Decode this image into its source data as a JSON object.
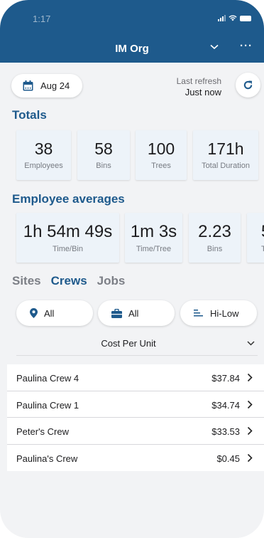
{
  "status": {
    "time": "1:17"
  },
  "header": {
    "title": "IM Org"
  },
  "date": {
    "label": "Aug 24"
  },
  "refresh": {
    "label": "Last refresh",
    "value": "Just now"
  },
  "totals": {
    "title": "Totals",
    "cards": [
      {
        "value": "38",
        "label": "Employees"
      },
      {
        "value": "58",
        "label": "Bins"
      },
      {
        "value": "100",
        "label": "Trees"
      },
      {
        "value": "171h",
        "label": "Total Duration"
      }
    ]
  },
  "averages": {
    "title": "Employee averages",
    "cards": [
      {
        "value": "1h 54m 49s",
        "label": "Time/Bin"
      },
      {
        "value": "1m 3s",
        "label": "Time/Tree"
      },
      {
        "value": "2.23",
        "label": "Bins"
      },
      {
        "value": "5",
        "label": "T"
      }
    ]
  },
  "tabs": [
    "Sites",
    "Crews",
    "Jobs"
  ],
  "active_tab": "Crews",
  "filters": {
    "site": "All",
    "job": "All",
    "order": "Hi-Low"
  },
  "sort": {
    "label": "Cost Per Unit"
  },
  "rows": [
    {
      "name": "Paulina Crew 4",
      "value": "$37.84"
    },
    {
      "name": "Paulina Crew 1",
      "value": "$34.74"
    },
    {
      "name": "Peter's Crew",
      "value": "$33.53"
    },
    {
      "name": "Paulina's Crew",
      "value": "$0.45"
    }
  ],
  "colors": {
    "brand": "#1e5a8c",
    "card": "#edf3f9",
    "background": "#f2f3f5"
  }
}
